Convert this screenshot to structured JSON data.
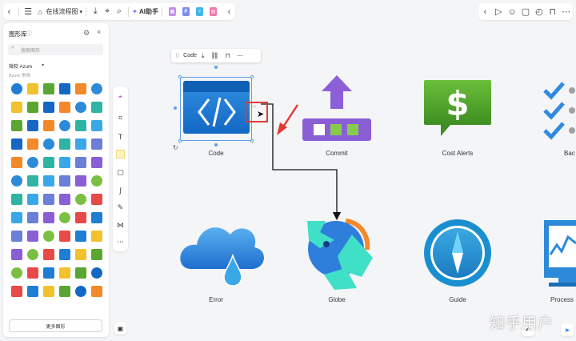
{
  "toolbar": {
    "title": "在线流程图",
    "ai_label": "AI助手"
  },
  "sidebar": {
    "title": "图形库",
    "search_placeholder": "搜索图形",
    "category": "微软 Azure",
    "subcategory": "Azure 常用",
    "more_button": "更多图形"
  },
  "float_toolbar": {
    "label": "Code"
  },
  "canvas": {
    "nodes": [
      {
        "label": "Code"
      },
      {
        "label": "Commit"
      },
      {
        "label": "Cost Alerts"
      },
      {
        "label": "Bac"
      },
      {
        "label": "Error"
      },
      {
        "label": "Globe"
      },
      {
        "label": "Guide"
      },
      {
        "label": "Process"
      }
    ]
  },
  "watermark": "知乎用户",
  "colors": {
    "accent": "#1677ff",
    "azure_blue": "#1f7ed4",
    "commit_purple": "#8a5fd6",
    "cost_green": "#5aa632",
    "annotation_red": "#e53935"
  },
  "icons": {
    "back": "chevron-left-icon",
    "menu": "hamburger-icon",
    "export": "export-icon",
    "tag": "tag-icon",
    "search": "search-icon",
    "play": "play-icon",
    "comment": "comment-icon",
    "history": "history-icon",
    "lock": "lock-icon"
  }
}
